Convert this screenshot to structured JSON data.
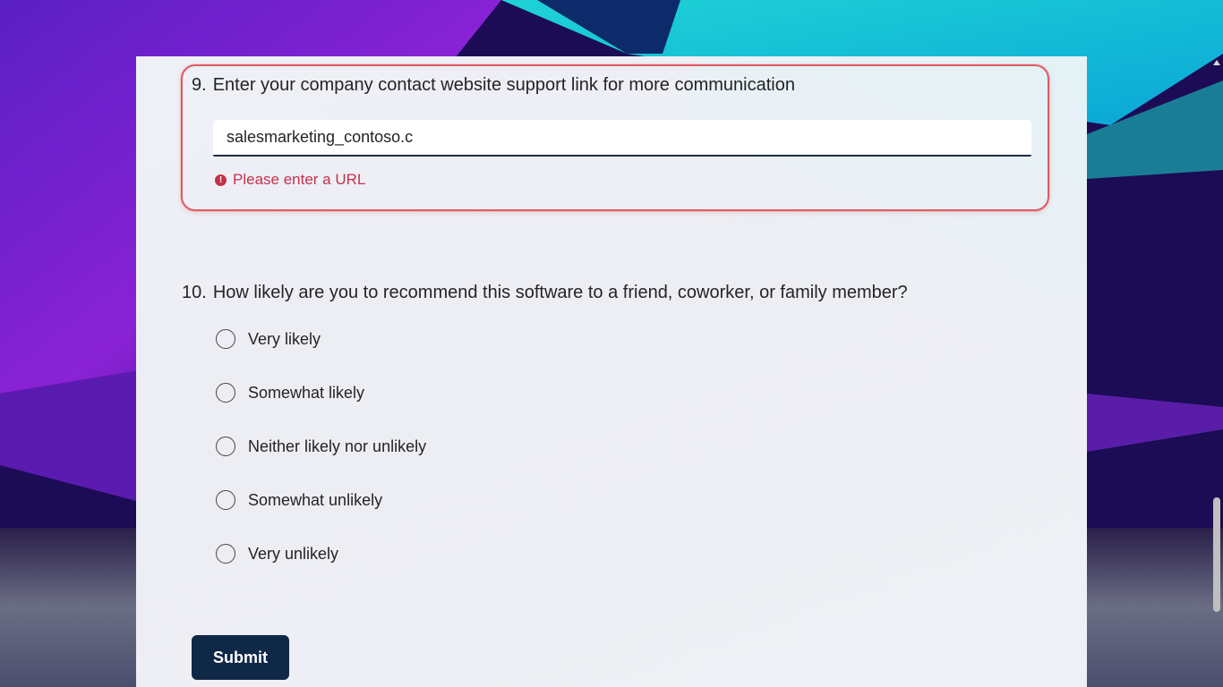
{
  "colors": {
    "accent_error": "#c4314b",
    "highlight_border": "#e05a5f",
    "submit_bg": "#0f2847"
  },
  "question9": {
    "number": "9.",
    "title": "Enter your company contact website support link for more communication",
    "input_value": "salesmarketing_contoso.c",
    "error_icon": "error-circle-icon",
    "error_text": "Please enter a URL"
  },
  "question10": {
    "number": "10.",
    "title": "How likely are you to recommend this software to a friend, coworker, or family member?",
    "options": [
      "Very likely",
      "Somewhat likely",
      "Neither likely nor unlikely",
      "Somewhat unlikely",
      "Very unlikely"
    ]
  },
  "submit": {
    "label": "Submit"
  }
}
